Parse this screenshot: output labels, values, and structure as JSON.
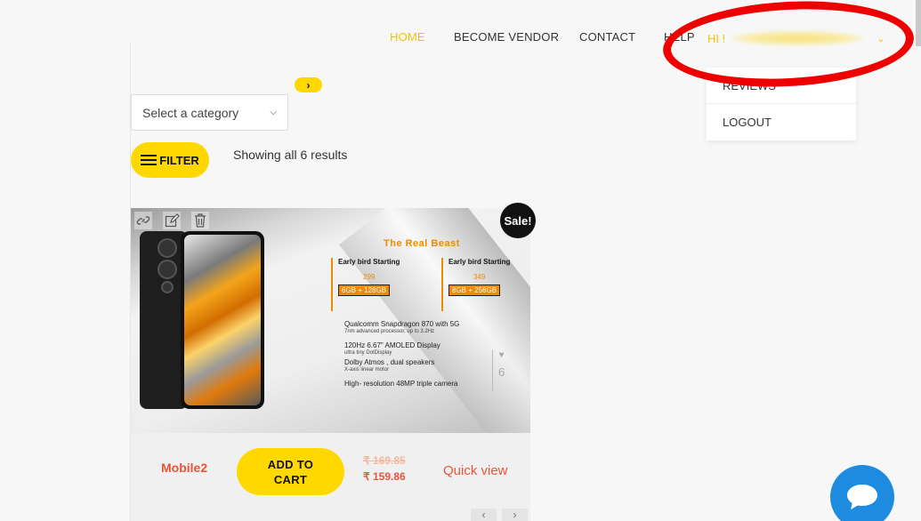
{
  "nav": {
    "home": "HOME",
    "become_vendor": "BECOME VENDOR",
    "contact": "CONTACT",
    "help": "HELP",
    "greeting": "HI !"
  },
  "dropdown": {
    "items": [
      "REVIEWS",
      "LOGOUT"
    ]
  },
  "filters": {
    "category_placeholder": "Select a category",
    "filter_label": "FILTER",
    "results_text": "Showing all 6 results"
  },
  "product": {
    "name": "Mobile2",
    "sale_badge": "Sale!",
    "add_to_cart_line1": "ADD TO",
    "add_to_cart_line2": "CART",
    "old_price": "₹ 169.85",
    "new_price": "₹ 159.86",
    "quick_view": "Quick view",
    "favorites_count": "6",
    "image_text": {
      "title": "The Real Beast",
      "offer1_label": "Early bird Starting",
      "offer1_price": "299",
      "offer1_spec": "6GB + 128GB",
      "offer2_label": "Early bird Starting",
      "offer2_price": "349",
      "offer2_spec": "8GB + 256GB",
      "spec1": "Qualcomm Snapdragon 870 with 5G",
      "spec1_sub": "7nm advanced processor, up to 3.2Hz",
      "spec2": "120Hz 6.67\" AMOLED Display",
      "spec2_sub": "ultra tiny DotDisplay",
      "spec3": "Dolby Atmos , dual speakers",
      "spec3_sub": "X-axis linear motor",
      "spec4": "High- resolution 48MP triple camera"
    }
  },
  "colors": {
    "accent_yellow": "#ffd800",
    "link_orange": "#e9553a",
    "chat_blue": "#1c8be0"
  }
}
